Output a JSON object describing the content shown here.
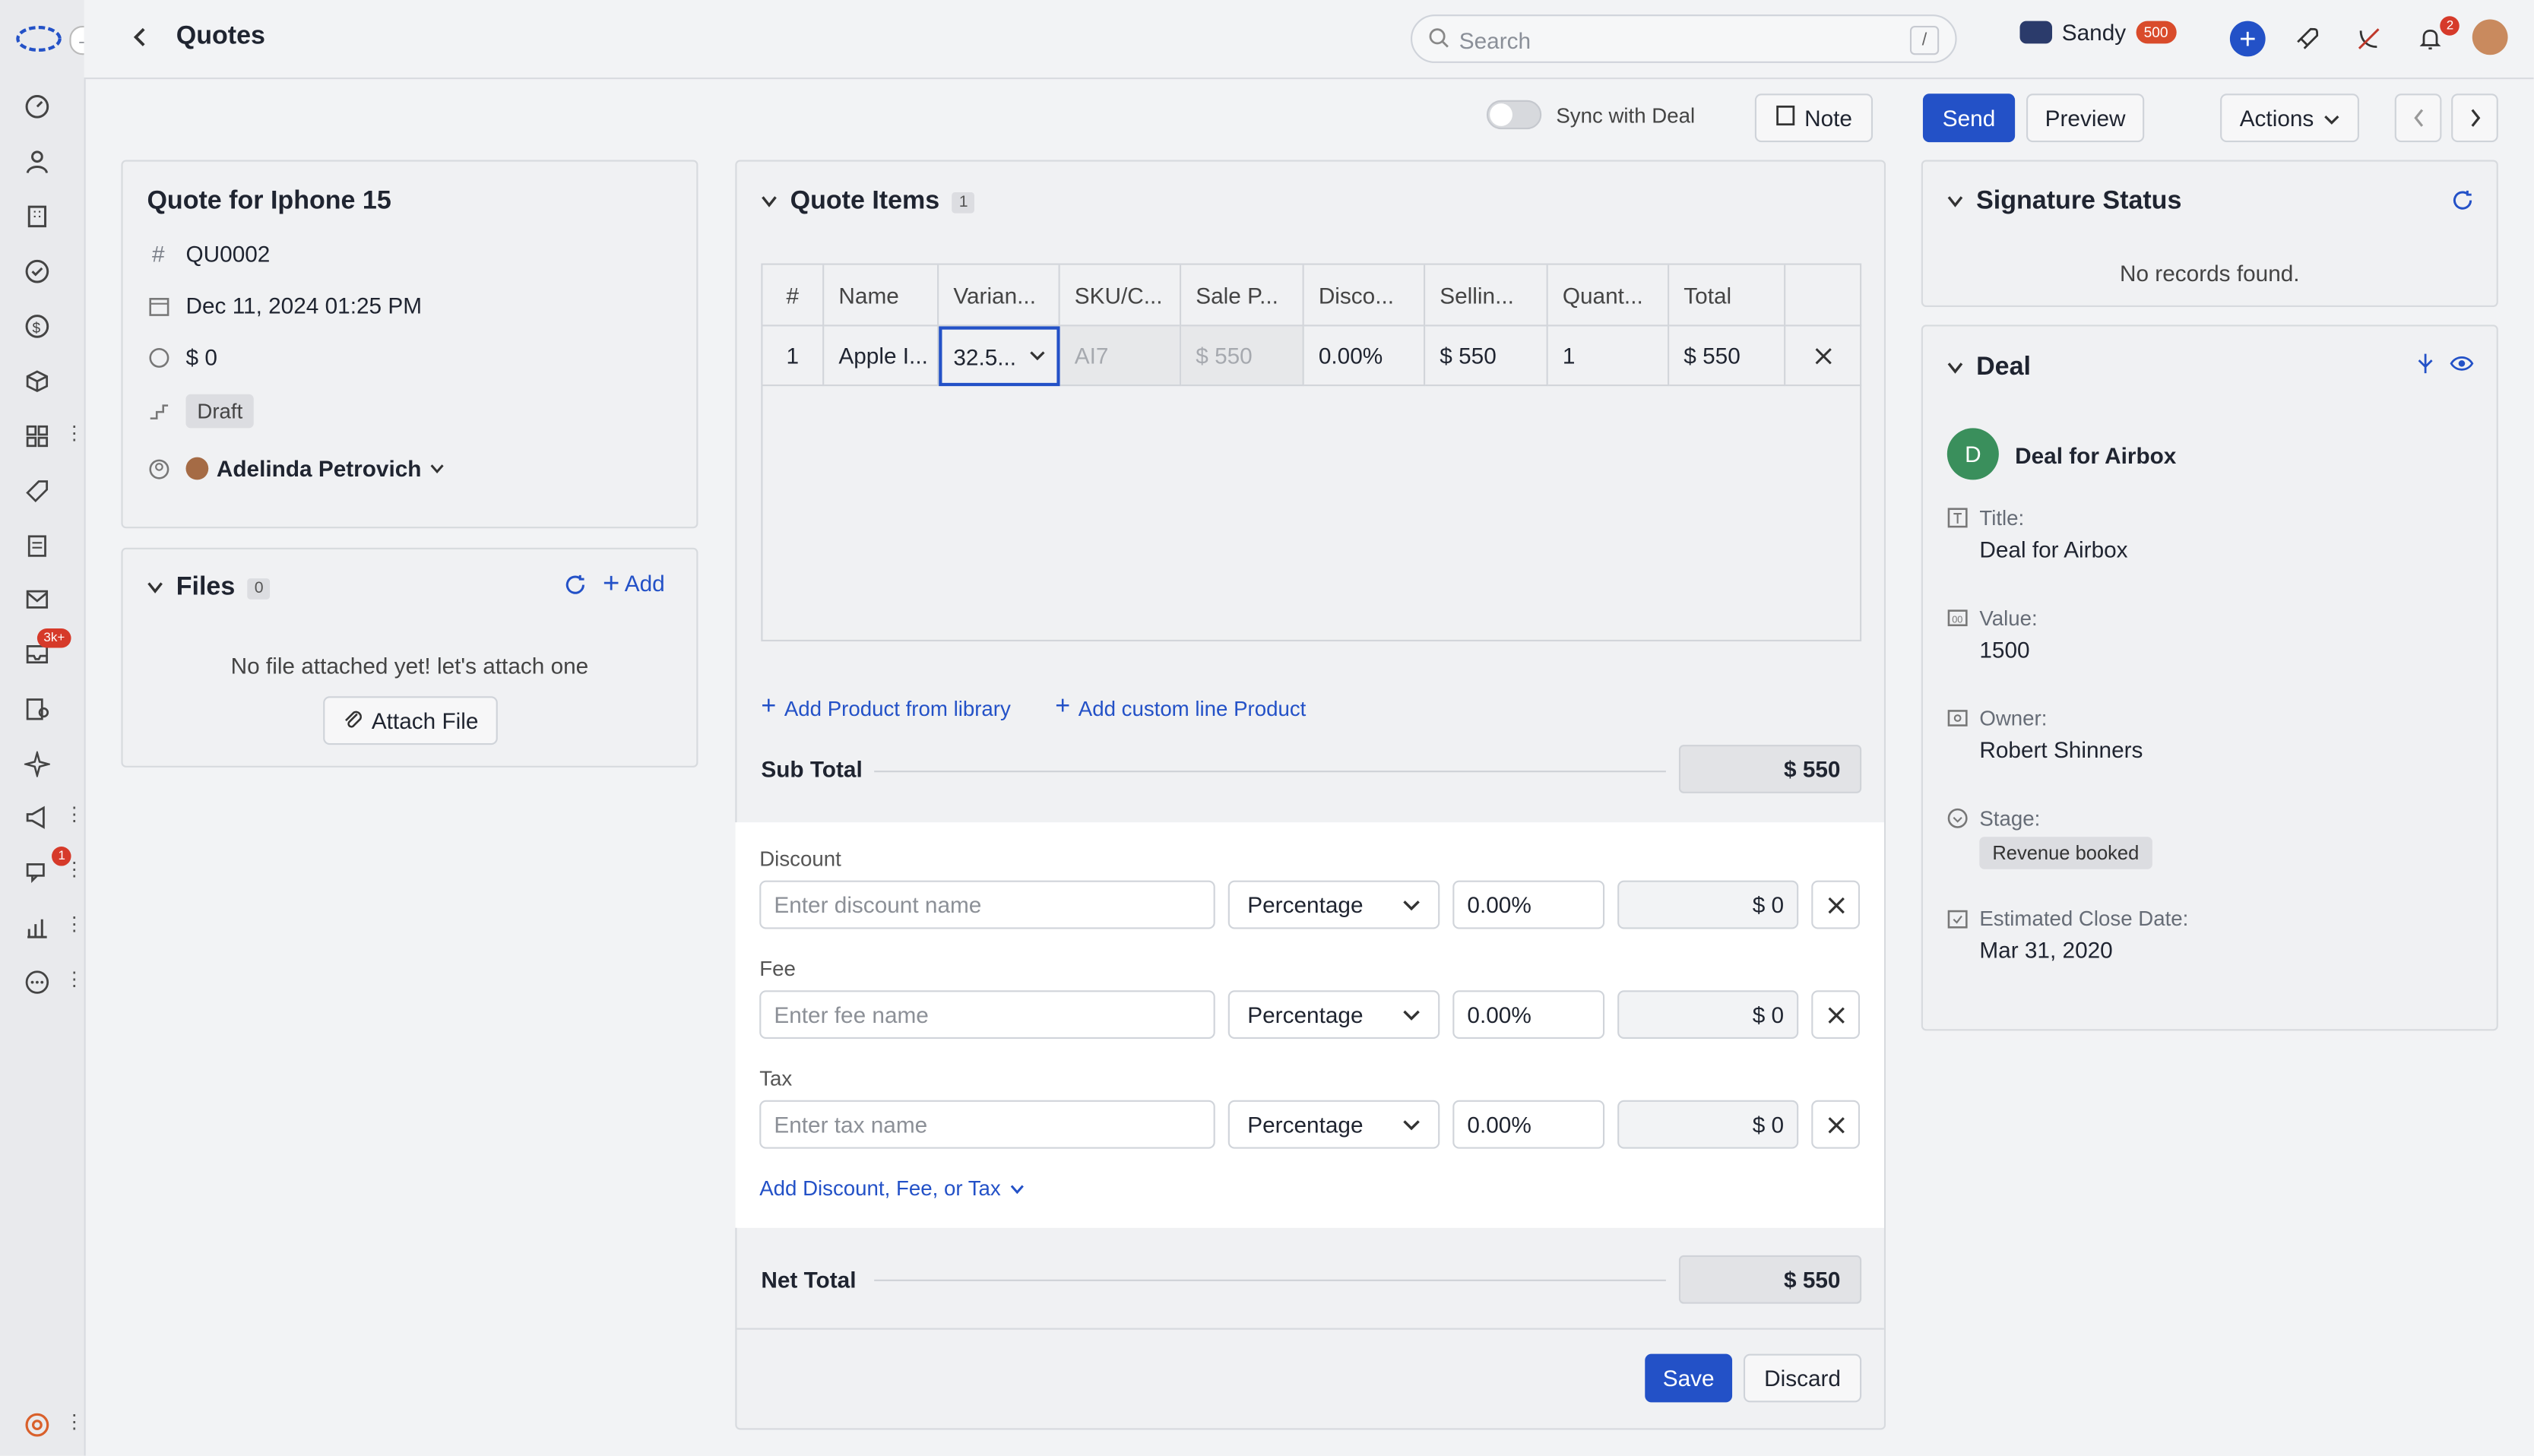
{
  "topbar": {
    "title": "Quotes",
    "search_placeholder": "Search",
    "search_shortcut": "/",
    "user_name": "Sandy",
    "credits": "500",
    "notification_count": "2"
  },
  "sidebar": {
    "inbox_badge": "3k+",
    "chat_badge": "1"
  },
  "toolbar": {
    "sync_label": "Sync with Deal",
    "note_label": "Note",
    "send_label": "Send",
    "preview_label": "Preview",
    "actions_label": "Actions"
  },
  "quote_summary": {
    "title": "Quote for Iphone 15",
    "number": "QU0002",
    "date": "Dec 11, 2024 01:25 PM",
    "amount": "$ 0",
    "stage": "Draft",
    "owner": "Adelinda Petrovich"
  },
  "files": {
    "title": "Files",
    "count": "0",
    "add_label": "Add",
    "empty_text": "No file attached yet! let's attach one",
    "attach_label": "Attach File"
  },
  "quote_items": {
    "title": "Quote Items",
    "count": "1",
    "columns": [
      "#",
      "Name",
      "Varian...",
      "SKU/C...",
      "Sale P...",
      "Disco...",
      "Sellin...",
      "Quant...",
      "Total"
    ],
    "rows": [
      [
        "1",
        "Apple I...",
        "32.5...",
        "AI7",
        "$ 550",
        "0.00%",
        "$ 550",
        "1",
        "$ 550"
      ]
    ],
    "add_library_label": "Add Product from library",
    "add_custom_label": "Add custom line Product",
    "subtotal_label": "Sub Total",
    "subtotal_value": "$ 550"
  },
  "adjustments": {
    "discount": {
      "label": "Discount",
      "placeholder": "Enter discount name",
      "type": "Percentage",
      "rate": "0.00%",
      "amount": "$ 0"
    },
    "fee": {
      "label": "Fee",
      "placeholder": "Enter fee name",
      "type": "Percentage",
      "rate": "0.00%",
      "amount": "$ 0"
    },
    "tax": {
      "label": "Tax",
      "placeholder": "Enter tax name",
      "type": "Percentage",
      "rate": "0.00%",
      "amount": "$ 0"
    },
    "add_more_label": "Add Discount, Fee, or Tax"
  },
  "net_total": {
    "label": "Net Total",
    "value": "$ 550"
  },
  "footer": {
    "save_label": "Save",
    "discard_label": "Discard"
  },
  "signature": {
    "title": "Signature Status",
    "empty_text": "No records found."
  },
  "deal": {
    "title": "Deal",
    "avatar_letter": "D",
    "name": "Deal for Airbox",
    "title_label": "Title:",
    "title_value": "Deal for Airbox",
    "value_label": "Value:",
    "value_value": "1500",
    "owner_label": "Owner:",
    "owner_value": "Robert Shinners",
    "stage_label": "Stage:",
    "stage_value": "Revenue booked",
    "close_label": "Estimated Close Date:",
    "close_value": "Mar 31, 2020"
  },
  "colors": {
    "accent": "#2351c7",
    "badge": "#d63a2a",
    "avatar": "#3a8f5c"
  }
}
